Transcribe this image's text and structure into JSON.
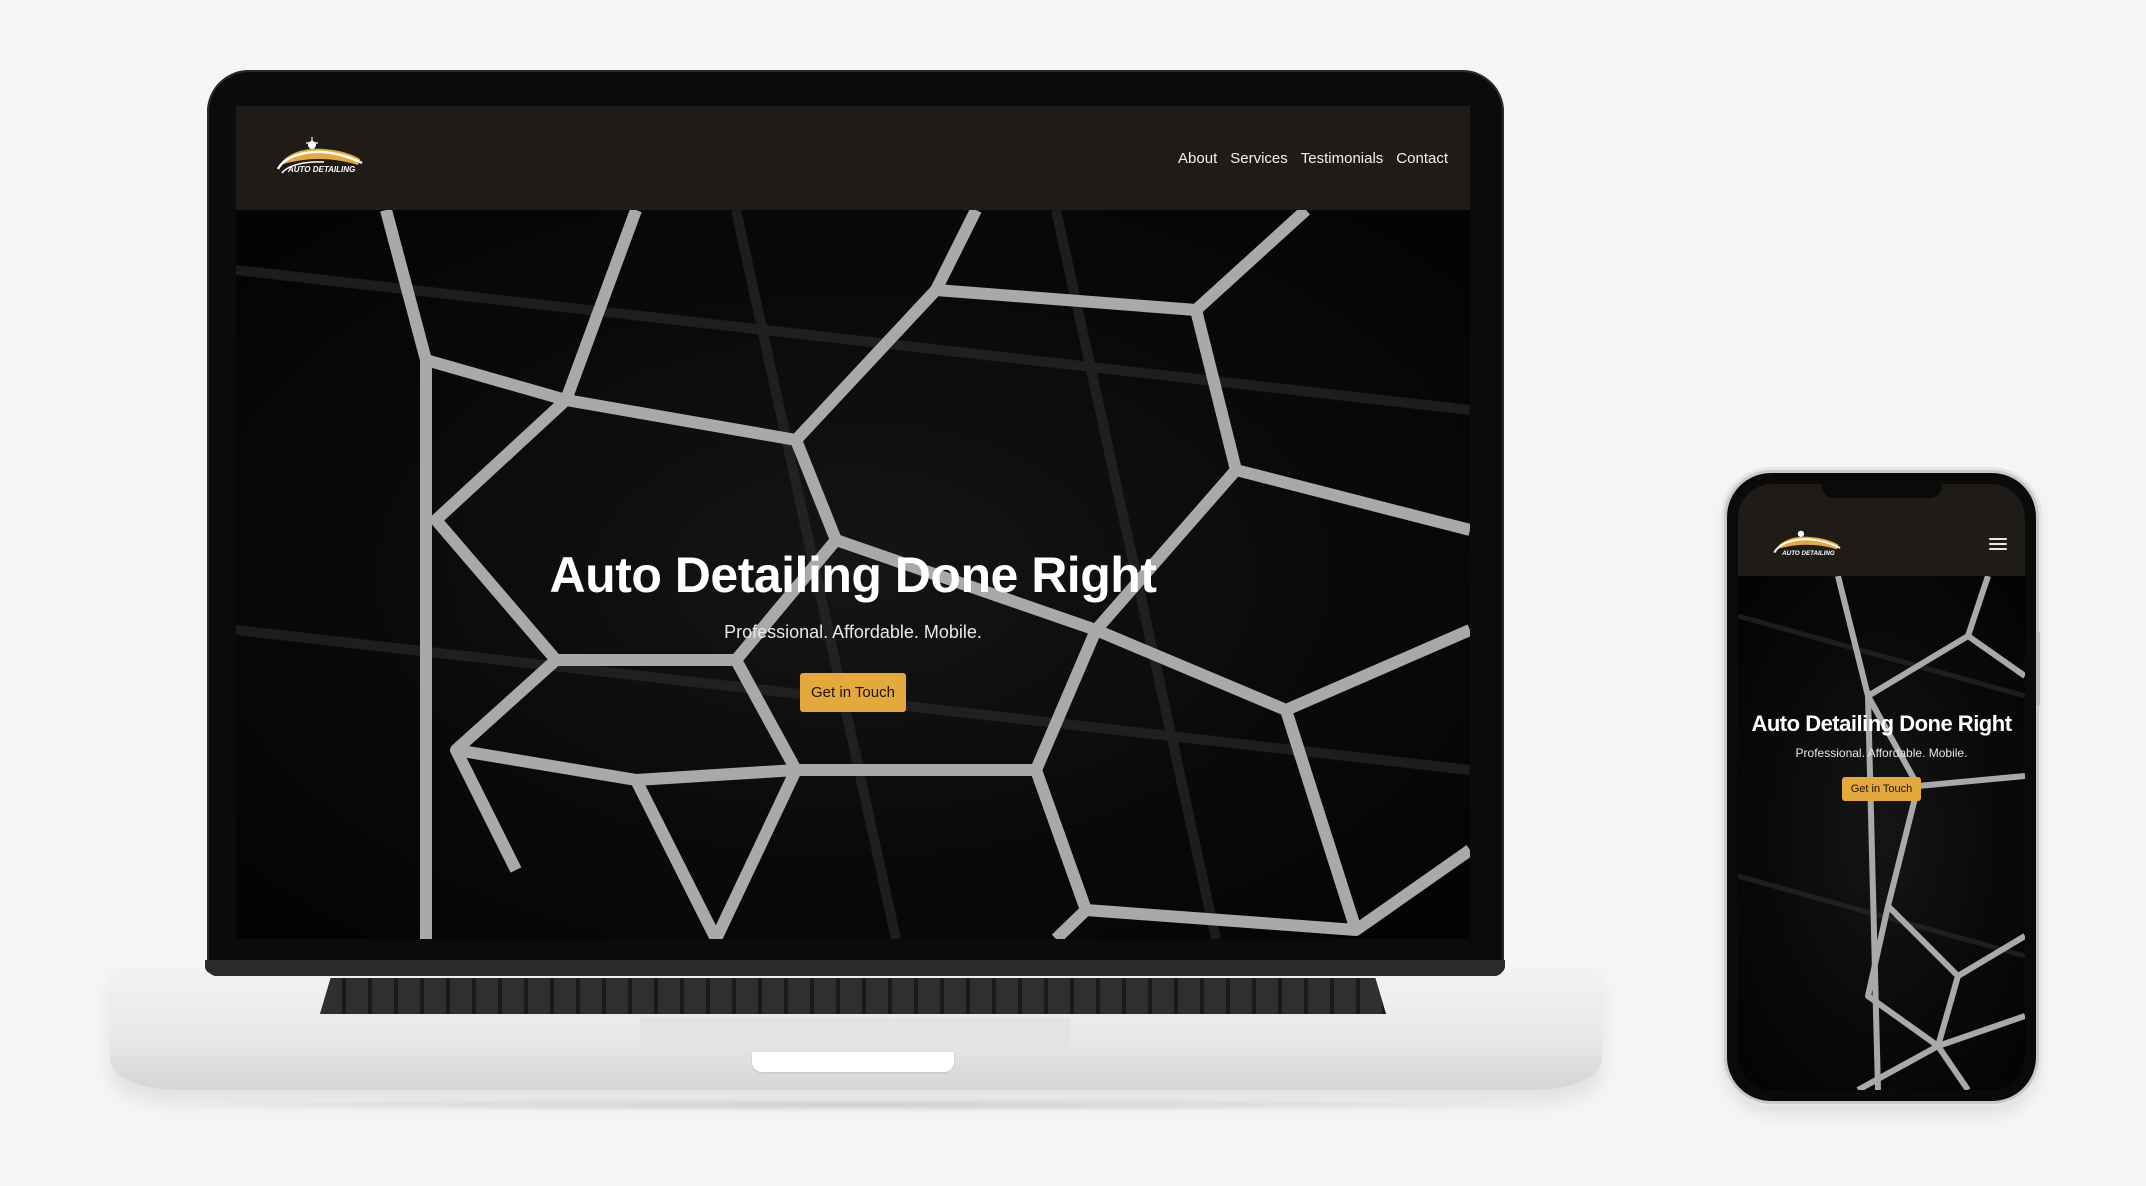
{
  "laptop": {
    "site": {
      "logo_text": "AUTO DETAILING",
      "nav": [
        {
          "label": "About"
        },
        {
          "label": "Services"
        },
        {
          "label": "Testimonials"
        },
        {
          "label": "Contact"
        }
      ],
      "hero": {
        "title": "Auto Detailing Done Right",
        "subtitle": "Professional. Affordable. Mobile.",
        "cta_label": "Get in Touch"
      }
    }
  },
  "phone": {
    "site": {
      "logo_text": "AUTO DETAILING",
      "menu_icon": "hamburger-menu-icon",
      "hero": {
        "title": "Auto Detailing Done Right",
        "subtitle": "Professional. Affordable. Mobile.",
        "cta_label": "Get in Touch"
      }
    }
  },
  "colors": {
    "accent": "#e4a93b",
    "nav_bg": "#1f1c18",
    "page_bg": "#f5f5f5"
  }
}
